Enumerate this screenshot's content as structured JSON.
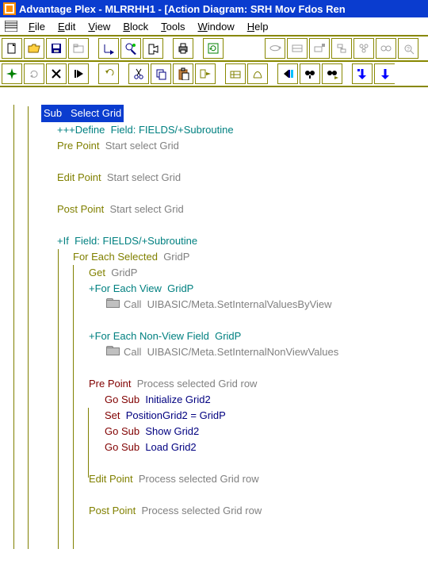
{
  "title": "Advantage Plex - MLRRHH1 - [Action Diagram: SRH Mov Fdos Ren",
  "menu": [
    "File",
    "Edit",
    "View",
    "Block",
    "Tools",
    "Window",
    "Help"
  ],
  "toolbar1": [
    "new",
    "open",
    "save",
    "folder",
    "spacer",
    "step-into",
    "step-over",
    "stop",
    "spacer",
    "print",
    "spacer",
    "refresh",
    "spacer-big",
    "b1",
    "b2",
    "b3",
    "b4",
    "b5",
    "b6",
    "b7"
  ],
  "toolbar2": [
    "c1",
    "c2",
    "c3",
    "c4",
    "spacer",
    "undo",
    "spacer",
    "cut",
    "copy",
    "paste",
    "move-right",
    "spacer",
    "w1",
    "w2",
    "spacer",
    "w3",
    "binoc",
    "binoc2",
    "spacer",
    "d1",
    "d2"
  ],
  "tree": {
    "sub": {
      "kw": "Sub",
      "val": "Select Grid"
    },
    "define": {
      "kw": "+++Define",
      "val": "Field: FIELDS/+Subroutine"
    },
    "prepoint1": {
      "kw": "Pre Point",
      "val": "Start select Grid"
    },
    "editpoint1": {
      "kw": "Edit Point",
      "val": "Start select Grid"
    },
    "postpoint1": {
      "kw": "Post Point",
      "val": "Start select Grid"
    },
    "if": {
      "kw": "+If",
      "val": "Field: FIELDS/+Subroutine"
    },
    "foreachsel": {
      "kw": "For Each Selected",
      "val": "GridP"
    },
    "get": {
      "kw": "Get",
      "val": "GridP"
    },
    "foreachview": {
      "kw": "+For Each View",
      "val": "GridP"
    },
    "call1": {
      "kw": "Call",
      "val": "UIBASIC/Meta.SetInternalValuesByView"
    },
    "foreachnv": {
      "kw": "+For Each Non-View Field",
      "val": "GridP"
    },
    "call2": {
      "kw": "Call",
      "val": "UIBASIC/Meta.SetInternalNonViewValues"
    },
    "prepoint2": {
      "kw": "Pre Point",
      "val": "Process selected Grid row"
    },
    "gosub1": {
      "kw": "Go Sub",
      "val": "Initialize Grid2"
    },
    "set": {
      "kw": "Set",
      "val": "PositionGrid2 = GridP"
    },
    "gosub2": {
      "kw": "Go Sub",
      "val": "Show Grid2"
    },
    "gosub3": {
      "kw": "Go Sub",
      "val": "Load Grid2"
    },
    "editpoint2": {
      "kw": "Edit Point",
      "val": "Process selected Grid row"
    },
    "postpoint2": {
      "kw": "Post Point",
      "val": "Process selected Grid row"
    }
  }
}
